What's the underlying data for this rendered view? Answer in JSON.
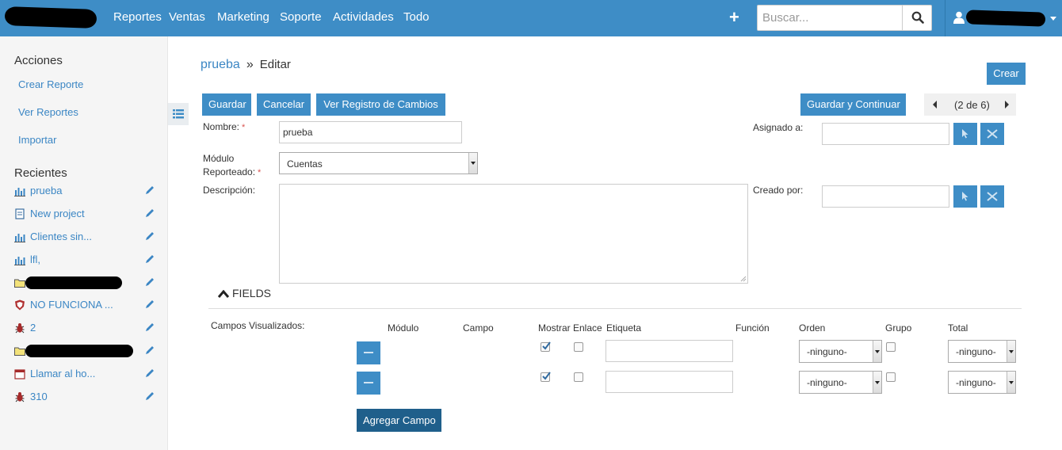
{
  "nav": {
    "items": [
      "Reportes",
      "Ventas",
      "Marketing",
      "Soporte",
      "Actividades",
      "Todo"
    ],
    "plus_label": "+",
    "search_placeholder": "Buscar..."
  },
  "sidebar": {
    "actions_heading": "Acciones",
    "actions": [
      "Crear Reporte",
      "Ver Reportes",
      "Importar"
    ],
    "recent_heading": "Recientes",
    "recents": [
      {
        "label": "prueba",
        "icon": "report-icon"
      },
      {
        "label": "New project",
        "icon": "project-icon"
      },
      {
        "label": "Clientes sin...",
        "icon": "report-icon"
      },
      {
        "label": "lfl,",
        "icon": "report-icon"
      },
      {
        "label": "",
        "icon": "folder-icon"
      },
      {
        "label": "NO FUNCIONA ...",
        "icon": "shield-icon"
      },
      {
        "label": "2",
        "icon": "bug-icon"
      },
      {
        "label": "",
        "icon": "folder-icon"
      },
      {
        "label": "Llamar al ho...",
        "icon": "calendar-icon"
      },
      {
        "label": "310",
        "icon": "bug-icon"
      }
    ]
  },
  "breadcrumb": {
    "module": "prueba",
    "separator": "»",
    "current": "Editar"
  },
  "buttons": {
    "crear": "Crear",
    "guardar": "Guardar",
    "cancelar": "Cancelar",
    "ver_registro": "Ver Registro de Cambios",
    "guardar_continuar": "Guardar y Continuar",
    "agregar_campo": "Agregar Campo"
  },
  "pager": {
    "text": "(2 de 6)"
  },
  "form": {
    "nombre_label": "Nombre:",
    "nombre_value": "prueba",
    "modulo_label_1": "Módulo",
    "modulo_label_2": "Reporteado:",
    "modulo_value": "Cuentas",
    "descripcion_label": "Descripción:",
    "asignado_label": "Asignado a:",
    "creado_label": "Creado por:",
    "required_mark": "*"
  },
  "fields": {
    "toggle_label": "FIELDS",
    "campos_label": "Campos Visualizados:",
    "columns": [
      "Módulo",
      "Campo",
      "Mostrar",
      "Enlace",
      "Etiqueta",
      "Función",
      "Orden",
      "Grupo",
      "Total"
    ],
    "rows": [
      {
        "mostrar": true,
        "enlace": false,
        "orden": "-ninguno-",
        "grupo": false,
        "total": "-ninguno-"
      },
      {
        "mostrar": true,
        "enlace": false,
        "orden": "-ninguno-",
        "grupo": false,
        "total": "-ninguno-"
      }
    ]
  },
  "colors": {
    "brand": "#3e8dc6",
    "link": "#3b86c4",
    "button_dark": "#1f5f8b",
    "sidebar_bg": "#f5f5f5"
  }
}
